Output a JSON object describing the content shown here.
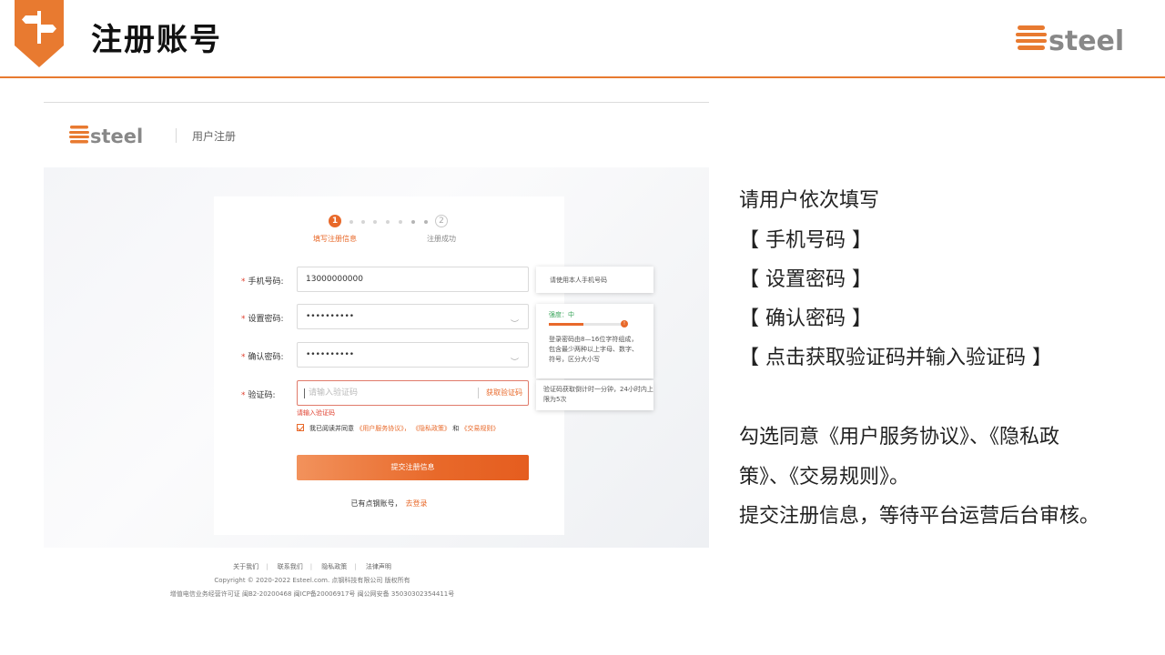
{
  "slide": {
    "title": "注册账号",
    "logo_text": "esteel",
    "accent_color": "#e87a30"
  },
  "screenshot": {
    "logo_text": "esteel",
    "heading": "用户注册",
    "steps": [
      {
        "number": "1",
        "label": "填写注册信息",
        "state": "active"
      },
      {
        "number": "2",
        "label": "注册成功",
        "state": "pending"
      }
    ],
    "fields": {
      "phone": {
        "label": "手机号码:",
        "value": "13000000000"
      },
      "password": {
        "label": "设置密码:",
        "value": "••••••••••",
        "icon": "eye-icon"
      },
      "confirm": {
        "label": "确认密码:",
        "value": "••••••••••",
        "icon": "eye-icon"
      },
      "code": {
        "label": "验证码:",
        "placeholder": "请输入验证码",
        "button": "获取验证码",
        "error": "请输入验证码"
      }
    },
    "required_mark": "*",
    "agreement": {
      "text": "我已阅读并同意",
      "link1": "《用户服务协议》，",
      "link2": "《隐私政策》",
      "and": "和",
      "link3": "《交易规则》"
    },
    "submit_label": "提交注册信息",
    "login_prompt": "已有点钢账号，",
    "login_link": "去登录",
    "tips": {
      "phone": "请使用本人手机号码",
      "strength_label": "强度：中",
      "strength_level": 0.45,
      "password_rule": "登录密码由8—16位字符组成，包含最少两种以上字母、数字、符号，区分大小写",
      "code_rule": "验证码获取倒计时一分钟，24小时内上限为5次"
    },
    "footer": {
      "links": [
        "关于我们",
        "联系我们",
        "隐私政策",
        "法律声明"
      ],
      "copyright": "Copyright © 2020-2022 Esteel.com. 点钢科技有限公司 版权所有",
      "icp": "增值电信业务经营许可证 闽B2-20200468 闽ICP备20006917号 闽公网安备 35030302354411号"
    }
  },
  "instructions": {
    "intro": "请用户依次填写",
    "items": [
      "【 手机号码 】",
      "【 设置密码 】",
      "【 确认密码 】",
      "【 点击获取验证码并输入验证码 】"
    ],
    "agree_line1": "勾选同意《用户服务协议》、《隐私政",
    "agree_line2": "策》、《交易规则》。",
    "submit_line": "提交注册信息，等待平台运营后台审核。"
  }
}
